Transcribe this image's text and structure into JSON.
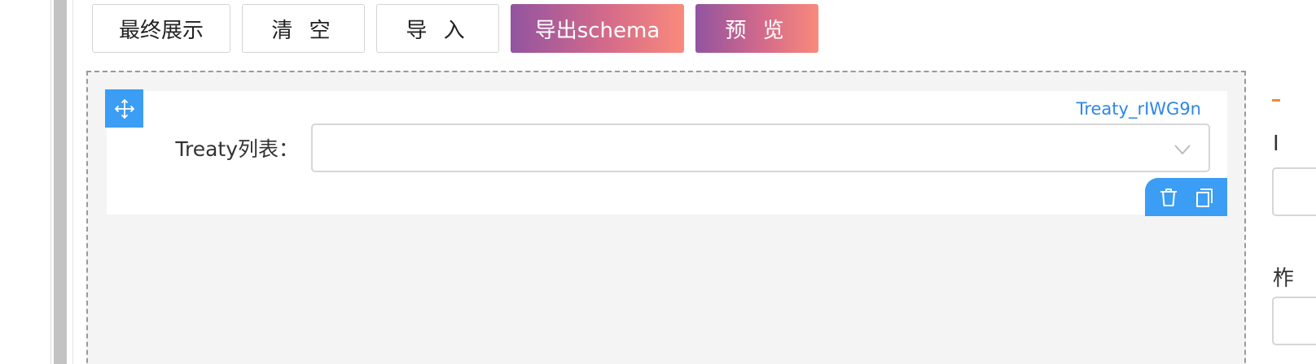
{
  "toolbar": {
    "final_display": "最终展示",
    "clear": "清 空",
    "import": "导 入",
    "export_schema": "导出schema",
    "preview": "预 览"
  },
  "field": {
    "id": "Treaty_rIWG9n",
    "label": "Treaty列表：",
    "value": ""
  },
  "right_panel": {
    "partial_label_1": "I",
    "partial_label_2": "柞"
  },
  "colors": {
    "accent_blue": "#3b9df3",
    "gradient_start": "#9254a0",
    "gradient_end": "#f98a7c",
    "id_text": "#2d87e6"
  },
  "icons": [
    "move-icon",
    "chevron-down-icon",
    "delete-icon",
    "copy-icon"
  ]
}
